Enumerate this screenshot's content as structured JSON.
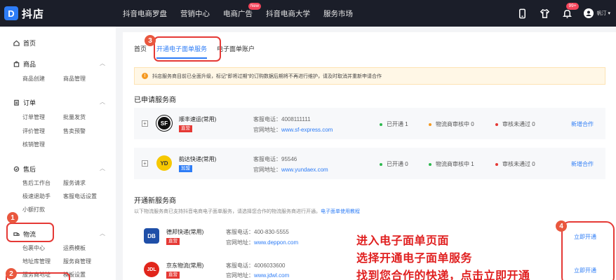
{
  "app": {
    "logo_letter": "D",
    "title": "抖店"
  },
  "topnav": [
    {
      "label": "抖音电商罗盘"
    },
    {
      "label": "营销中心"
    },
    {
      "label": "电商广告",
      "badge": "New"
    },
    {
      "label": "抖音电商大学"
    },
    {
      "label": "服务市场"
    }
  ],
  "topright": {
    "notif_badge": "99+",
    "user_name": "帆汀"
  },
  "sidebar": {
    "home": "首页",
    "groups": [
      {
        "title": "商品",
        "items": [
          "商品创建",
          "商品管理"
        ]
      },
      {
        "title": "订单",
        "items": [
          "订单管理",
          "批量发货",
          "评价管理",
          "售卖预警",
          "核销管理"
        ]
      },
      {
        "title": "售后",
        "items": [
          "售后工作台",
          "服务请求",
          "极速退助手",
          "客服电话设置",
          "小额打款"
        ]
      },
      {
        "title": "物流",
        "items": [
          "包裹中心",
          "运费模板",
          "地址库管理",
          "服务商管理",
          "服务商地址",
          "模板设置"
        ]
      }
    ]
  },
  "tabs": {
    "first": "首页",
    "active": "开通电子面单服务",
    "third": "电子面单账户"
  },
  "notice": {
    "text": "抖店服务商目前已全面升级，标记\"即将过期\"的订购数据后期将不再进行维护，请及时取消并重新申请合作"
  },
  "applied": {
    "title": "已申请服务商",
    "carriers": [
      {
        "name": "顺丰速运(常用)",
        "tag": "直营",
        "tag_color": "#e53935",
        "logo": "SF",
        "phone_label": "客服电话：",
        "phone": "4008111111",
        "site_label": "官网地址：",
        "site": "www.sf-express.com",
        "opened": "已开通 1",
        "reviewing": "物流商审核中 0",
        "rejected": "审核未通过 0",
        "action": "新增合作"
      },
      {
        "name": "韵达快递(常用)",
        "tag": "加盟",
        "tag_color": "#2d7cf6",
        "logo": "YD",
        "phone_label": "客服电话：",
        "phone": "95546",
        "site_label": "官网地址：",
        "site": "www.yundaex.com",
        "opened": "已开通 0",
        "reviewing": "物流商审核中 1",
        "rejected": "审核未通过 0",
        "action": "新增合作"
      }
    ]
  },
  "new_section": {
    "title": "开通新服务商",
    "desc": "以下物流服务商已支持抖音电商电子面单服务，请选择您合作的物流服务商进行开通。",
    "link": "电子面单使用教程",
    "carriers": [
      {
        "name": "德邦快递(常用)",
        "tag": "直营",
        "logo": "DB",
        "phone_label": "客服电话：",
        "phone": "400-830-5555",
        "site_label": "官网地址：",
        "site": "www.deppon.com",
        "action": "立即开通"
      },
      {
        "name": "京东物流(常用)",
        "tag": "直营",
        "logo": "JDL",
        "phone_label": "客服电话：",
        "phone": "4006033600",
        "site_label": "官网地址：",
        "site": "www.jdwl.com",
        "action": "立即开通"
      }
    ]
  },
  "annotations": {
    "badges": [
      "1",
      "2",
      "3",
      "4"
    ],
    "lines": [
      "进入电子面单页面",
      "选择开通电子面单服务",
      "找到您合作的快递，点击立即开通"
    ]
  },
  "colors": {
    "accent": "#2d7cf6",
    "annotation_red": "#e53935",
    "topbar": "#1b1e29"
  }
}
